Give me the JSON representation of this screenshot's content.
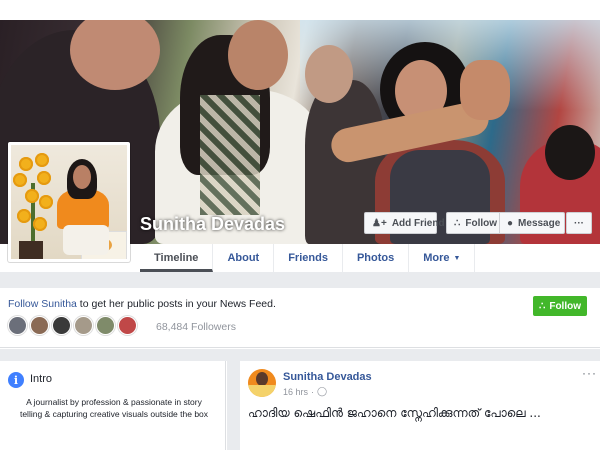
{
  "profile": {
    "name": "Sunitha Devadas"
  },
  "actions": {
    "add_friend": "Add Friend",
    "follow": "Follow",
    "message": "Message",
    "more": "···"
  },
  "nav": {
    "tabs": [
      {
        "label": "Timeline",
        "active": true
      },
      {
        "label": "About"
      },
      {
        "label": "Friends"
      },
      {
        "label": "Photos"
      },
      {
        "label": "More"
      }
    ]
  },
  "follow_banner": {
    "text_prefix": "Follow ",
    "link": "Sunitha",
    "text_suffix": " to get her public posts in your News Feed.",
    "button": "Follow",
    "followers": "68,484 Followers",
    "avatar_colors": [
      "#6b6f7a",
      "#8a6a55",
      "#3a3a3a",
      "#a59a8a",
      "#7f8b6a",
      "#c04848"
    ]
  },
  "intro": {
    "title": "Intro",
    "icon": "i",
    "bio": "A journalist by profession & passionate in story telling & capturing creative visuals outside the box"
  },
  "post": {
    "author": "Sunitha Devadas",
    "time": "16 hrs",
    "separator": "·",
    "menu": "···",
    "text": "ഹാദിയ ഷെഫിൻ ജഹാനെ സ്നേഹിക്കുന്നത് പോലെ ..."
  },
  "colors": {
    "link": "#365899",
    "follow_green": "#42b72a",
    "background_gray": "#e9ebee"
  }
}
